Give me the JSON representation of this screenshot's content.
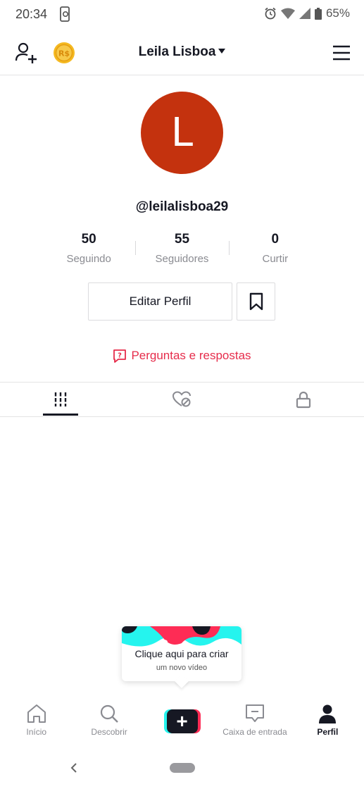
{
  "status_bar": {
    "time": "20:34",
    "battery": "65%"
  },
  "header": {
    "title": "Leila Lisboa"
  },
  "profile": {
    "avatar_letter": "L",
    "avatar_color": "#c4320e",
    "username": "@leilalisboa29",
    "stats": [
      {
        "value": "50",
        "label": "Seguindo"
      },
      {
        "value": "55",
        "label": "Seguidores"
      },
      {
        "value": "0",
        "label": "Curtir"
      }
    ],
    "edit_label": "Editar Perfil",
    "qa_label": "Perguntas e respostas"
  },
  "tooltip": {
    "title": "Clique aqui para criar",
    "subtitle": "um novo vídeo"
  },
  "bottom_nav": {
    "items": [
      {
        "label": "Início"
      },
      {
        "label": "Descobrir"
      },
      {
        "label": "Caixa de entrada"
      },
      {
        "label": "Perfil"
      }
    ]
  },
  "colors": {
    "accent": "#fe2c55",
    "link": "#e62c4b",
    "cyan": "#25f4ee",
    "text": "#161823"
  }
}
